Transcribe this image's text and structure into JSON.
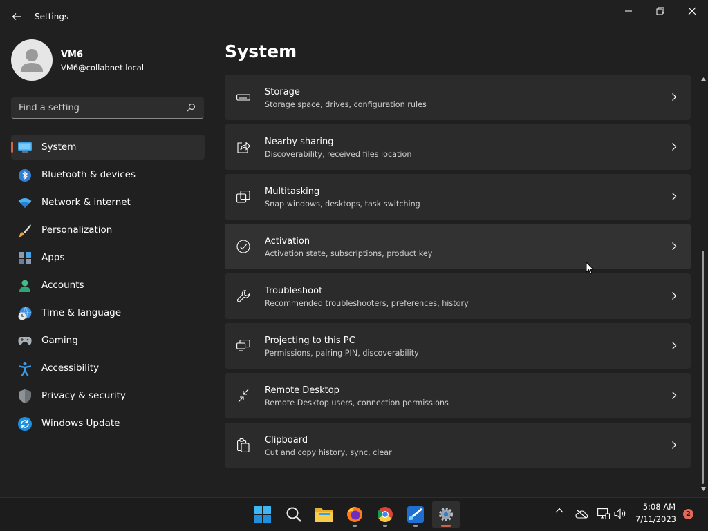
{
  "window": {
    "title": "Settings"
  },
  "user": {
    "name": "VM6",
    "email": "VM6@collabnet.local"
  },
  "search": {
    "placeholder": "Find a setting"
  },
  "sidebar": {
    "items": [
      {
        "label": "System",
        "icon": "monitor-icon",
        "active": true
      },
      {
        "label": "Bluetooth & devices",
        "icon": "bluetooth-icon"
      },
      {
        "label": "Network & internet",
        "icon": "wifi-icon"
      },
      {
        "label": "Personalization",
        "icon": "brush-icon"
      },
      {
        "label": "Apps",
        "icon": "apps-icon"
      },
      {
        "label": "Accounts",
        "icon": "person-icon"
      },
      {
        "label": "Time & language",
        "icon": "globe-clock-icon"
      },
      {
        "label": "Gaming",
        "icon": "gamepad-icon"
      },
      {
        "label": "Accessibility",
        "icon": "accessibility-icon"
      },
      {
        "label": "Privacy & security",
        "icon": "shield-icon"
      },
      {
        "label": "Windows Update",
        "icon": "update-icon"
      }
    ]
  },
  "main": {
    "title": "System",
    "cards": [
      {
        "title": "Storage",
        "subtitle": "Storage space, drives, configuration rules",
        "icon": "storage-icon"
      },
      {
        "title": "Nearby sharing",
        "subtitle": "Discoverability, received files location",
        "icon": "share-icon"
      },
      {
        "title": "Multitasking",
        "subtitle": "Snap windows, desktops, task switching",
        "icon": "multitasking-icon"
      },
      {
        "title": "Activation",
        "subtitle": "Activation state, subscriptions, product key",
        "icon": "check-circle-icon"
      },
      {
        "title": "Troubleshoot",
        "subtitle": "Recommended troubleshooters, preferences, history",
        "icon": "wrench-icon"
      },
      {
        "title": "Projecting to this PC",
        "subtitle": "Permissions, pairing PIN, discoverability",
        "icon": "projecting-icon"
      },
      {
        "title": "Remote Desktop",
        "subtitle": "Remote Desktop users, connection permissions",
        "icon": "remote-desktop-icon"
      },
      {
        "title": "Clipboard",
        "subtitle": "Cut and copy history, sync, clear",
        "icon": "clipboard-icon"
      }
    ]
  },
  "taskbar": {
    "apps": [
      "start-icon",
      "search-icon",
      "file-explorer-icon",
      "firefox-icon",
      "chrome-icon",
      "paint-icon",
      "settings-icon"
    ],
    "time": "5:08 AM",
    "date": "7/11/2023",
    "notification_count": "2"
  },
  "colors": {
    "accent": "#d0624a",
    "background": "#202020",
    "card": "#2b2b2b"
  }
}
